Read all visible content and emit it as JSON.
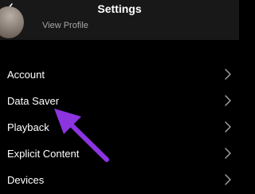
{
  "header": {
    "title": "Settings",
    "back_icon": "chevron-left-icon"
  },
  "profile": {
    "view_profile": "View Profile"
  },
  "settings": {
    "items": [
      {
        "label": "Account"
      },
      {
        "label": "Data Saver"
      },
      {
        "label": "Playback"
      },
      {
        "label": "Explicit Content"
      },
      {
        "label": "Devices"
      }
    ]
  },
  "annotation": {
    "arrow_color": "#8b34e0"
  },
  "colors": {
    "background": "#000000",
    "header_bg": "#181818",
    "text": "#ffffff",
    "secondary_text": "#a6a6a6",
    "chevron": "#a6a6a6"
  }
}
